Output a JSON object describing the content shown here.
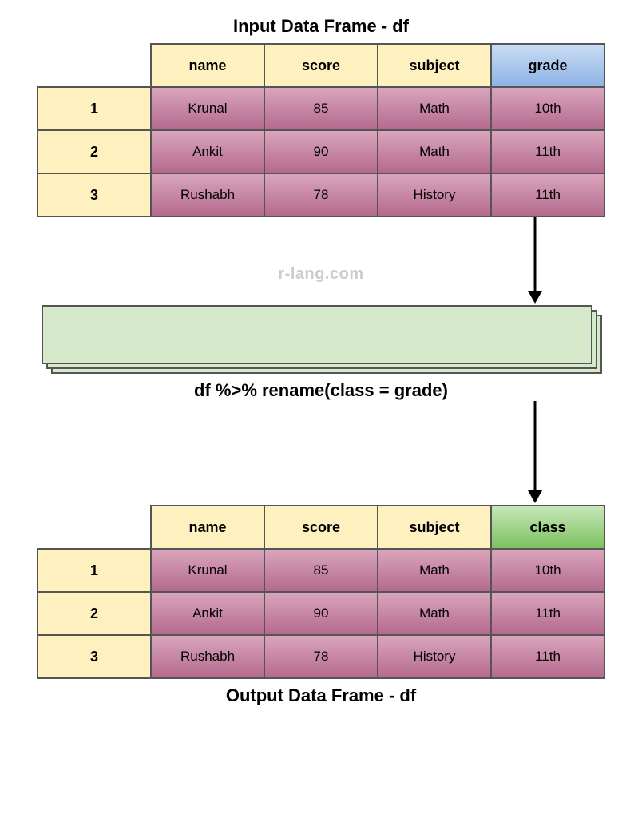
{
  "titles": {
    "input": "Input Data Frame - df",
    "output": "Output Data Frame - df"
  },
  "watermark": "r-lang.com",
  "code": "df %>% rename(class = grade)",
  "input_table": {
    "headers": {
      "h1": "name",
      "h2": "score",
      "h3": "subject",
      "h4": "grade"
    },
    "row_ids": {
      "r1": "1",
      "r2": "2",
      "r3": "3"
    },
    "rows": [
      {
        "name": "Krunal",
        "score": "85",
        "subject": "Math",
        "grade": "10th"
      },
      {
        "name": "Ankit",
        "score": "90",
        "subject": "Math",
        "grade": "11th"
      },
      {
        "name": "Rushabh",
        "score": "78",
        "subject": "History",
        "grade": "11th"
      }
    ]
  },
  "output_table": {
    "headers": {
      "h1": "name",
      "h2": "score",
      "h3": "subject",
      "h4": "class"
    },
    "row_ids": {
      "r1": "1",
      "r2": "2",
      "r3": "3"
    },
    "rows": [
      {
        "name": "Krunal",
        "score": "85",
        "subject": "Math",
        "class": "10th"
      },
      {
        "name": "Ankit",
        "score": "90",
        "subject": "Math",
        "class": "11th"
      },
      {
        "name": "Rushabh",
        "score": "78",
        "subject": "History",
        "class": "11th"
      }
    ]
  }
}
